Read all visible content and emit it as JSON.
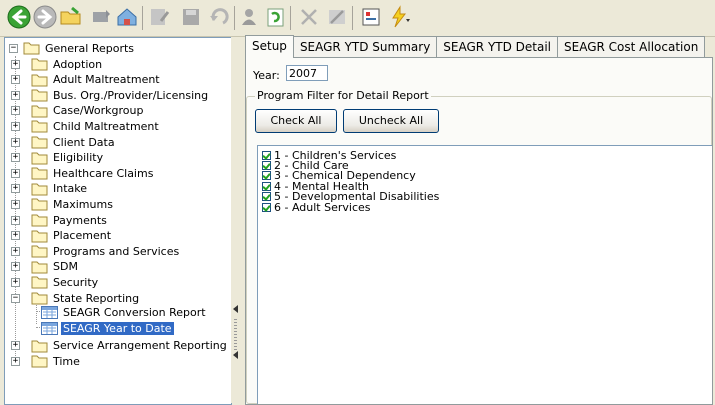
{
  "toolbar": {
    "buttons": [
      "back-icon",
      "forward-icon",
      "open-folder-icon",
      "pin-icon",
      "home-icon",
      "edit-icon",
      "save-icon",
      "undo-icon",
      "user-icon",
      "refresh-icon",
      "delete-icon",
      "tools-icon",
      "layout-icon",
      "run-icon"
    ]
  },
  "tree": {
    "root": "General Reports",
    "items": [
      "Adoption",
      "Adult Maltreatment",
      "Bus. Org./Provider/Licensing",
      "Case/Workgroup",
      "Child Maltreatment",
      "Client Data",
      "Eligibility",
      "Healthcare Claims",
      "Intake",
      "Maximums",
      "Payments",
      "Placement",
      "Programs and Services",
      "SDM",
      "Security",
      "State Reporting"
    ],
    "state_reporting_children": [
      "SEAGR Conversion Report",
      "SEAGR Year to Date"
    ],
    "after": [
      "Service Arrangement Reporting",
      "Time"
    ]
  },
  "tabs": [
    "Setup",
    "SEAGR YTD Summary",
    "SEAGR YTD Detail",
    "SEAGR Cost Allocation"
  ],
  "setup": {
    "year_label": "Year:",
    "year_value": "2007",
    "group_title": "Program Filter for Detail Report",
    "check_all": "Check All",
    "uncheck_all": "Uncheck All",
    "programs": [
      "1 - Children's Services",
      "2 - Child Care",
      "3 - Chemical Dependency",
      "4 - Mental Health",
      "5 - Developmental Disabilities",
      "6 - Adult Services"
    ]
  },
  "colors": {
    "selection": "#316ac5",
    "accent": "#3a8b2e"
  }
}
